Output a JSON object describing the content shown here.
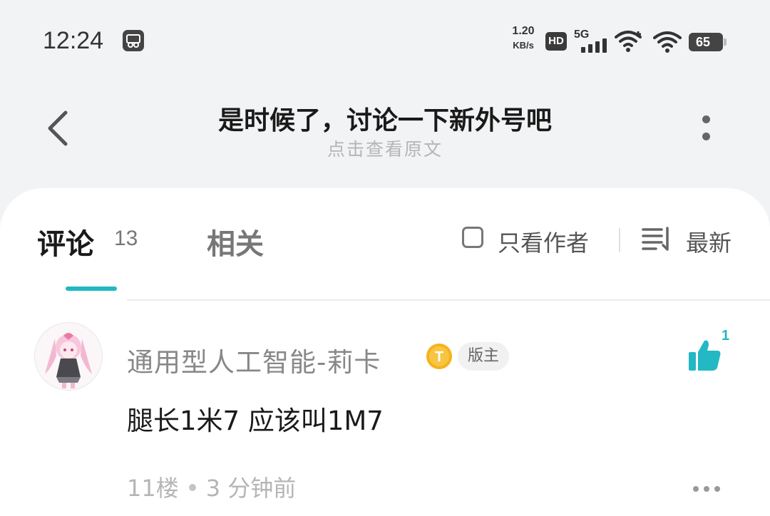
{
  "status_bar": {
    "time": "12:24",
    "net_speed_value": "1.20",
    "net_speed_unit": "KB/s",
    "hd_badge": "HD",
    "network_type": "5G",
    "battery": "65",
    "icons": [
      "screen-recorder-icon",
      "signal-icon",
      "wifi-plus-icon",
      "wifi-icon",
      "battery-icon"
    ]
  },
  "header": {
    "title": "是时候了，讨论一下新外号吧",
    "subtitle": "点击查看原文",
    "icons": [
      "back-icon",
      "more-vertical-icon"
    ]
  },
  "tabs": {
    "comments_label": "评论",
    "comments_count": "13",
    "related_label": "相关",
    "author_only_label": "只看作者",
    "sort_label": "最新",
    "accent_color": "#22b8c4"
  },
  "comment": {
    "username": "通用型人工智能-莉卡",
    "level_badge": "T",
    "role_badge": "版主",
    "like_count": "1",
    "text": "腿长1米7 应该叫1M7",
    "floor": "11楼",
    "time_ago": "3 分钟前"
  }
}
